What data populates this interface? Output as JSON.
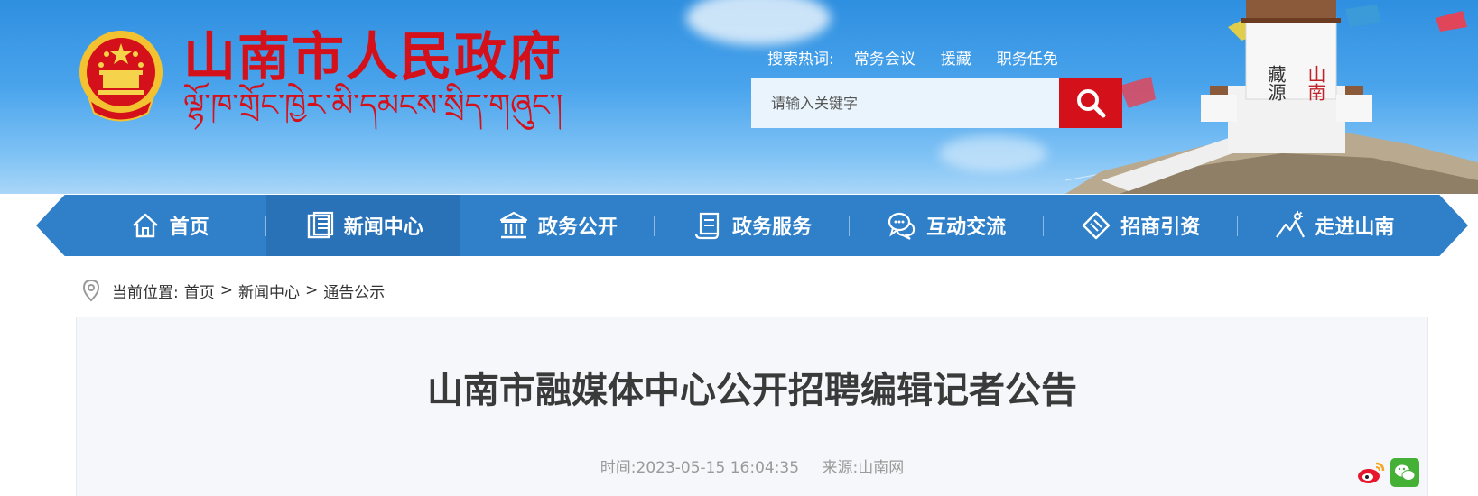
{
  "header": {
    "site_title": "山南市人民政府",
    "site_title_tibetan": "ལྷོ་ཁ་གྲོང་ཁྱེར་མི་དམངས་སྲིད་གཞུང་།",
    "tower_label_1": "藏源",
    "tower_label_2": "山南"
  },
  "search": {
    "hot_label": "搜索热词:",
    "hot_words": [
      "常务会议",
      "援藏",
      "职务任免"
    ],
    "placeholder": "请输入关键字"
  },
  "nav": {
    "items": [
      {
        "label": "首页",
        "icon": "home-icon"
      },
      {
        "label": "新闻中心",
        "icon": "news-icon"
      },
      {
        "label": "政务公开",
        "icon": "government-building-icon"
      },
      {
        "label": "政务服务",
        "icon": "service-scroll-icon"
      },
      {
        "label": "互动交流",
        "icon": "chat-bubbles-icon"
      },
      {
        "label": "招商引资",
        "icon": "handshake-icon"
      },
      {
        "label": "走进山南",
        "icon": "mountain-icon"
      }
    ],
    "active": "新闻中心"
  },
  "breadcrumb": {
    "prefix": "当前位置:",
    "items": [
      "首页",
      "新闻中心",
      "通告公示"
    ],
    "separator": ">"
  },
  "article": {
    "title": "山南市融媒体中心公开招聘编辑记者公告",
    "time": "时间:2023-05-15 16:04:35",
    "source": "来源:山南网"
  },
  "share": {
    "icons": [
      "weibo-icon",
      "wechat-icon"
    ]
  },
  "colors": {
    "brand_red": "#d4111a",
    "nav_blue": "#2f7fc9",
    "header_blue": "#4aa4ec"
  }
}
